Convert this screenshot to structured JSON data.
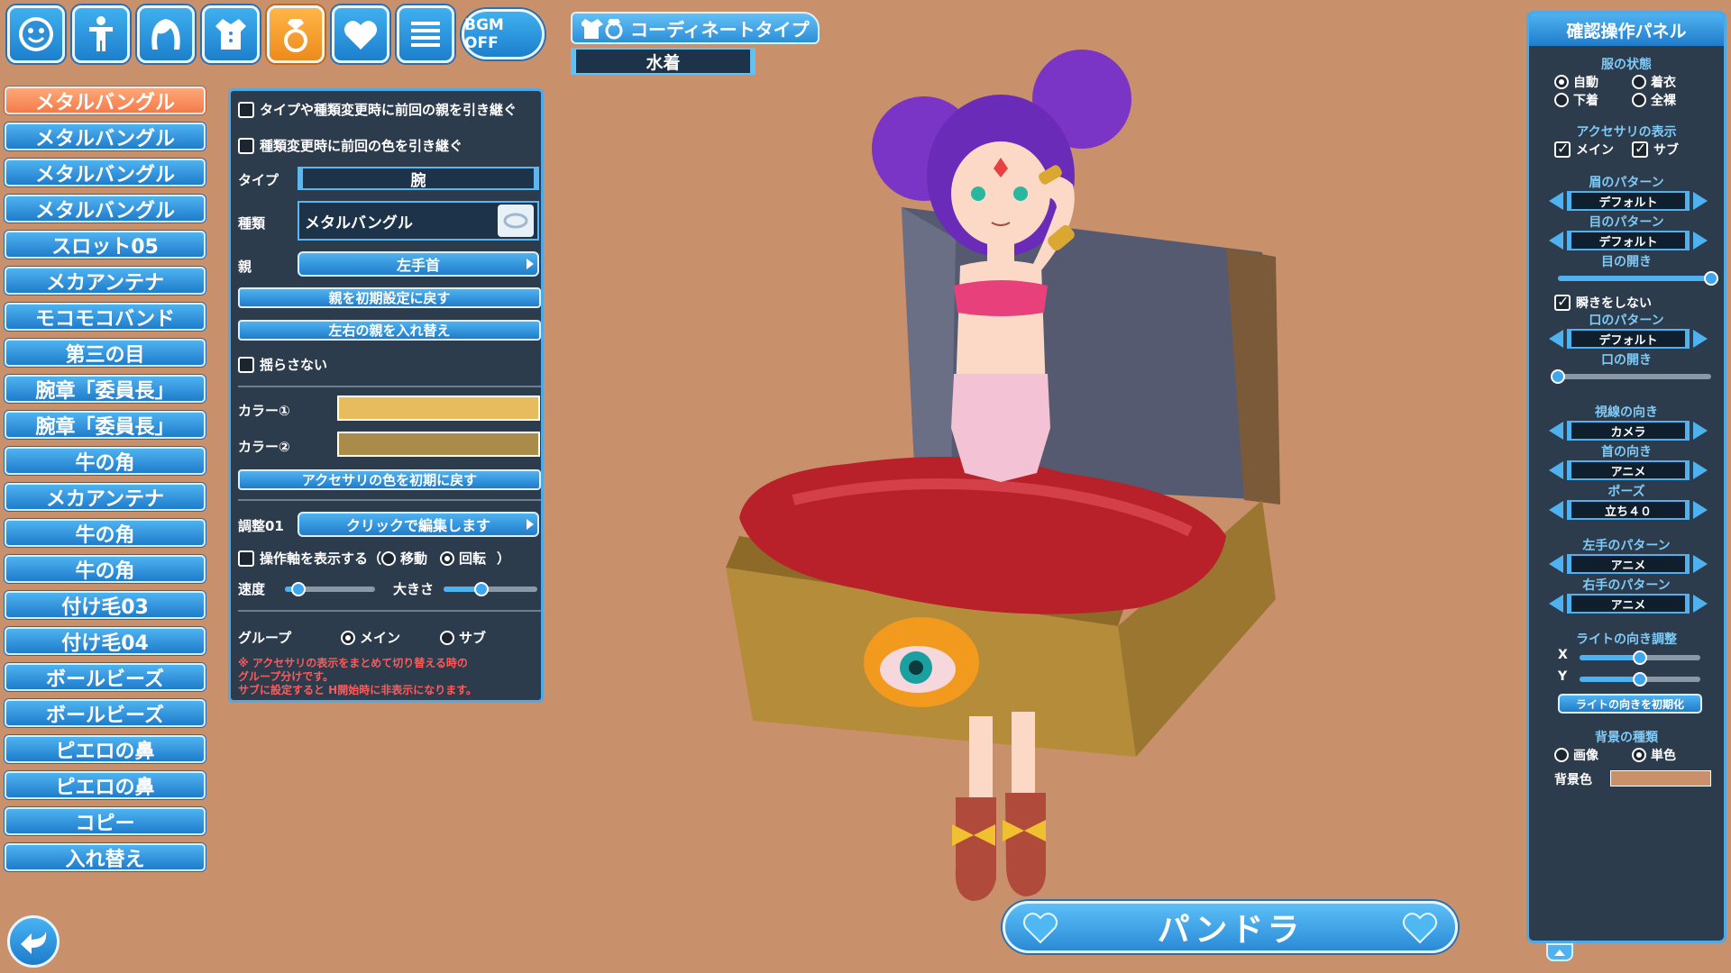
{
  "toolbar": {
    "bgm_label": "BGM OFF",
    "icons": [
      "face-icon",
      "body-icon",
      "hair-icon",
      "outfit-icon",
      "accessory-ring-icon",
      "heart-icon",
      "menu-icon"
    ],
    "active_icon": "accessory-ring-icon"
  },
  "coordinate": {
    "tab_label": "コーディネートタイプ",
    "value": "水着"
  },
  "slots": [
    "メタルバングル",
    "メタルバングル",
    "メタルバングル",
    "メタルバングル",
    "スロット05",
    "メカアンテナ",
    "モコモコバンド",
    "第三の目",
    "腕章「委員長」",
    "腕章「委員長」",
    "牛の角",
    "メカアンテナ",
    "牛の角",
    "牛の角",
    "付け毛03",
    "付け毛04",
    "ボールビーズ",
    "ボールビーズ",
    "ピエロの鼻",
    "ピエロの鼻",
    "コピー",
    "入れ替え"
  ],
  "accessory": {
    "keep_parent_label": "タイプや種類変更時に前回の親を引き継ぐ",
    "keep_color_label": "種類変更時に前回の色を引き継ぐ",
    "type_label": "タイプ",
    "type_value": "腕",
    "kind_label": "種類",
    "kind_value": "メタルバングル",
    "parent_label": "親",
    "parent_value": "左手首",
    "reset_parent_btn": "親を初期設定に戻す",
    "swap_parent_btn": "左右の親を入れ替え",
    "no_sway_label": "揺らさない",
    "color1_label": "カラー①",
    "color1": "#e6bc5e",
    "color2_label": "カラー②",
    "color2": "#a98b4a",
    "reset_color_btn": "アクセサリの色を初期に戻す",
    "adjust_label": "調整01",
    "adjust_btn": "クリックで編集します",
    "show_axis_label": "操作軸を表示する（",
    "move_label": "移動",
    "rotate_label": "回転",
    "close_paren": "）",
    "speed_label": "速度",
    "speed_value": 0.15,
    "size_label": "大きさ",
    "size_value": 0.4,
    "group_label": "グループ",
    "main_label": "メイン",
    "sub_label": "サブ",
    "notice": "※ アクセサリの表示をまとめて切り替える時の\nグループ分けです。\nサブに設定すると H開始時に非表示になります。"
  },
  "confirm_panel": {
    "title": "確認操作パネル",
    "clothing_state": "服の状態",
    "auto": "自動",
    "dressing": "着衣",
    "underwear": "下着",
    "naked": "全裸",
    "acc_display": "アクセサリの表示",
    "acc_main": "メイン",
    "acc_sub": "サブ",
    "brow_pattern": "眉のパターン",
    "brow_value": "デフォルト",
    "eye_pattern": "目のパターン",
    "eye_value": "デフォルト",
    "eye_open": "目の開き",
    "eye_open_value": 1.0,
    "no_blink": "瞬きをしない",
    "mouth_pattern": "口のパターン",
    "mouth_value": "デフォルト",
    "mouth_open": "口の開き",
    "mouth_open_value": 0.0,
    "gaze": "視線の向き",
    "gaze_value": "カメラ",
    "neck": "首の向き",
    "neck_value": "アニメ",
    "pose": "ポーズ",
    "pose_value": "立ち４０",
    "left_hand": "左手のパターン",
    "left_hand_value": "アニメ",
    "right_hand": "右手のパターン",
    "right_hand_value": "アニメ",
    "light_adjust": "ライトの向き調整",
    "x_label": "X",
    "x_value": 0.5,
    "y_label": "Y",
    "y_value": 0.5,
    "reset_light": "ライトの向きを初期化",
    "bg_type": "背景の種類",
    "bg_image": "画像",
    "bg_solid": "単色",
    "bg_color_label": "背景色",
    "bg_color": "#c9906c"
  },
  "character_name": "パンドラ"
}
